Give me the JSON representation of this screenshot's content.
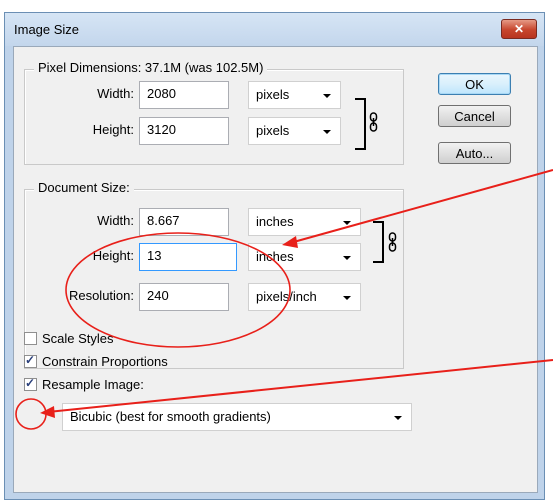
{
  "window": {
    "title": "Image Size",
    "close_glyph": "✕"
  },
  "pixel_dimensions": {
    "legend": "Pixel Dimensions:  37.1M (was 102.5M)",
    "width_label": "Width:",
    "width_value": "2080",
    "width_unit": "pixels",
    "height_label": "Height:",
    "height_value": "3120",
    "height_unit": "pixels"
  },
  "document_size": {
    "legend": "Document Size:",
    "width_label": "Width:",
    "width_value": "8.667",
    "width_unit": "inches",
    "height_label": "Height:",
    "height_value": "13",
    "height_unit": "inches",
    "resolution_label": "Resolution:",
    "resolution_value": "240",
    "resolution_unit": "pixels/inch"
  },
  "buttons": {
    "ok": "OK",
    "cancel": "Cancel",
    "auto": "Auto..."
  },
  "options": {
    "scale_styles": {
      "label": "Scale Styles",
      "checked": false
    },
    "constrain_proportions": {
      "label": "Constrain Proportions",
      "checked": true
    },
    "resample_image": {
      "label": "Resample Image:",
      "checked": true
    }
  },
  "resample_method": "Bicubic (best for smooth gradients)",
  "annotations": {
    "color": "#e8201a"
  },
  "icons": [
    "close-icon",
    "chain-link-icon",
    "dropdown-arrow-icon",
    "checkmark-icon"
  ]
}
